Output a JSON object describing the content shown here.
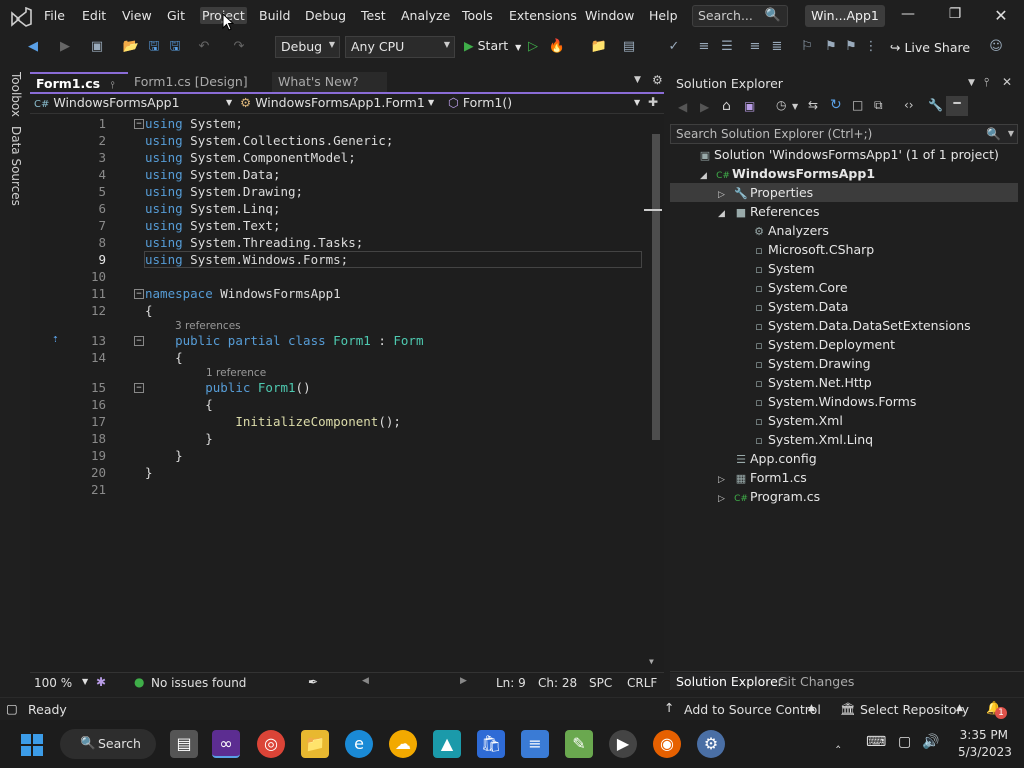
{
  "menu": [
    "File",
    "Edit",
    "View",
    "Git",
    "Project",
    "Build",
    "Debug",
    "Test",
    "Analyze",
    "Tools",
    "Extensions",
    "Window",
    "Help"
  ],
  "search": {
    "placeholder": "Search..."
  },
  "window_title": "Win...App1",
  "toolbar": {
    "config": "Debug",
    "platform": "Any CPU",
    "start": "Start",
    "live_share": "Live Share"
  },
  "side_tabs": [
    "Toolbox",
    "Data Sources"
  ],
  "doc_tabs": [
    {
      "label": "Form1.cs",
      "active": true
    },
    {
      "label": "Form1.cs [Design]",
      "active": false
    },
    {
      "label": "What's New?",
      "active": false
    }
  ],
  "navbar": {
    "project": "WindowsFormsApp1",
    "class": "WindowsFormsApp1.Form1",
    "member": "Form1()"
  },
  "code": {
    "line_numbers": [
      "1",
      "2",
      "3",
      "4",
      "5",
      "6",
      "7",
      "8",
      "9",
      "10",
      "11",
      "12",
      "13",
      "14",
      "15",
      "16",
      "17",
      "18",
      "19",
      "20",
      "21"
    ],
    "codelens_class": "3 references",
    "codelens_ctor": "1 reference"
  },
  "statusline": {
    "zoom": "100 %",
    "issues": "No issues found",
    "ln": "Ln: 9",
    "ch": "Ch: 28",
    "spc": "SPC",
    "crlf": "CRLF"
  },
  "solution_explorer": {
    "title": "Solution Explorer",
    "search_placeholder": "Search Solution Explorer (Ctrl+;)",
    "items": [
      {
        "label": "Solution 'WindowsFormsApp1' (1 of 1 project)",
        "indent": 0,
        "icon": "solution-icon",
        "expander": ""
      },
      {
        "label": "WindowsFormsApp1",
        "indent": 1,
        "icon": "csharp-project-icon",
        "expander": "open",
        "bold": true
      },
      {
        "label": "Properties",
        "indent": 2,
        "icon": "wrench-icon",
        "expander": "closed"
      },
      {
        "label": "References",
        "indent": 2,
        "icon": "references-icon",
        "expander": "open"
      },
      {
        "label": "Analyzers",
        "indent": 3,
        "icon": "analyzers-icon",
        "expander": ""
      },
      {
        "label": "Microsoft.CSharp",
        "indent": 3,
        "icon": "assembly-icon",
        "expander": ""
      },
      {
        "label": "System",
        "indent": 3,
        "icon": "assembly-icon",
        "expander": ""
      },
      {
        "label": "System.Core",
        "indent": 3,
        "icon": "assembly-icon",
        "expander": ""
      },
      {
        "label": "System.Data",
        "indent": 3,
        "icon": "assembly-icon",
        "expander": ""
      },
      {
        "label": "System.Data.DataSetExtensions",
        "indent": 3,
        "icon": "assembly-icon",
        "expander": ""
      },
      {
        "label": "System.Deployment",
        "indent": 3,
        "icon": "assembly-icon",
        "expander": ""
      },
      {
        "label": "System.Drawing",
        "indent": 3,
        "icon": "assembly-icon",
        "expander": ""
      },
      {
        "label": "System.Net.Http",
        "indent": 3,
        "icon": "assembly-icon",
        "expander": ""
      },
      {
        "label": "System.Windows.Forms",
        "indent": 3,
        "icon": "assembly-icon",
        "expander": ""
      },
      {
        "label": "System.Xml",
        "indent": 3,
        "icon": "assembly-icon",
        "expander": ""
      },
      {
        "label": "System.Xml.Linq",
        "indent": 3,
        "icon": "assembly-icon",
        "expander": ""
      },
      {
        "label": "App.config",
        "indent": 2,
        "icon": "config-file-icon",
        "expander": ""
      },
      {
        "label": "Form1.cs",
        "indent": 2,
        "icon": "form-icon",
        "expander": "closed"
      },
      {
        "label": "Program.cs",
        "indent": 2,
        "icon": "csharp-file-icon",
        "expander": "closed"
      }
    ],
    "bottom_tabs": [
      "Solution Explorer",
      "Git Changes"
    ]
  },
  "statusbar": {
    "ready": "Ready",
    "source_control": "Add to Source Control",
    "repository": "Select Repository",
    "notifications": "1"
  },
  "taskbar": {
    "search": "Search",
    "time": "3:35 PM",
    "date": "5/3/2023"
  },
  "colors": {
    "accent": "#8a6cd6",
    "keyword": "#569cd6",
    "type": "#4ec9b0",
    "method": "#dcdcaa"
  }
}
